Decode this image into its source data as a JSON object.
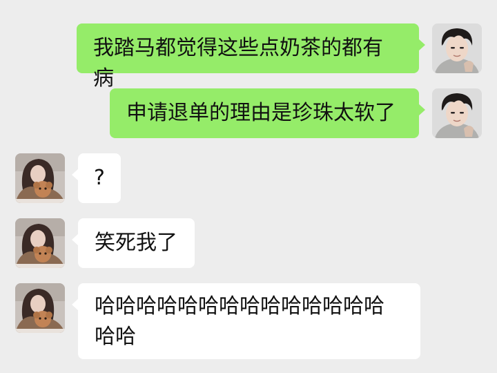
{
  "chat": {
    "messages": [
      {
        "sender": "me",
        "text": "我踏马都觉得这些点奶茶的都有病"
      },
      {
        "sender": "me",
        "text": "申请退单的理由是珍珠太软了"
      },
      {
        "sender": "friend",
        "text": "?"
      },
      {
        "sender": "friend",
        "text": "笑死我了"
      },
      {
        "sender": "friend",
        "text": "哈哈哈哈哈哈哈哈哈哈哈哈哈哈哈哈"
      }
    ]
  },
  "colors": {
    "background": "#ededed",
    "sent_bubble": "#95ec69",
    "received_bubble": "#ffffff",
    "text": "#111111"
  }
}
